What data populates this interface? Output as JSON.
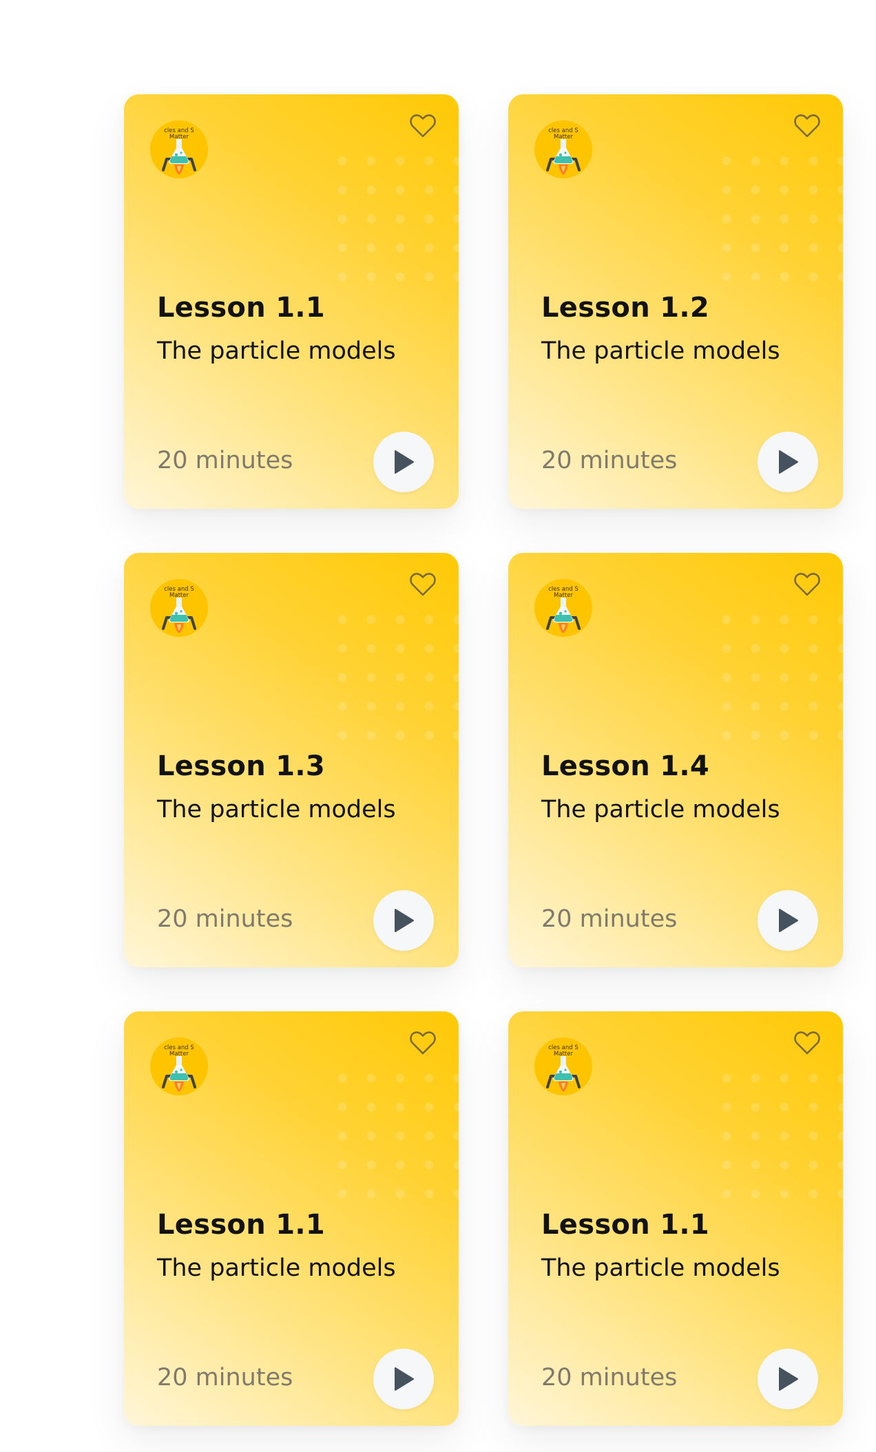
{
  "colors": {
    "card_top": "#ffc905",
    "card_bottom": "#fff6d8",
    "play_icon": "#46525e",
    "heart_icon": "#7a6a3a",
    "duration_text": "#7f7a6c"
  },
  "lessons": [
    {
      "title": "Lesson 1.1",
      "subtitle": "The particle models",
      "duration": "20 minutes",
      "thumbnail_text": [
        "cles and S",
        "Matter"
      ]
    },
    {
      "title": "Lesson 1.2",
      "subtitle": "The particle models",
      "duration": "20 minutes",
      "thumbnail_text": [
        "cles and S",
        "Matter"
      ]
    },
    {
      "title": "Lesson 1.3",
      "subtitle": "The particle models",
      "duration": "20 minutes",
      "thumbnail_text": [
        "cles and S",
        "Matter"
      ]
    },
    {
      "title": "Lesson 1.4",
      "subtitle": "The particle models",
      "duration": "20 minutes",
      "thumbnail_text": [
        "cles and S",
        "Matter"
      ]
    },
    {
      "title": "Lesson 1.1",
      "subtitle": "The particle models",
      "duration": "20 minutes",
      "thumbnail_text": [
        "cles and S",
        "Matter"
      ]
    },
    {
      "title": "Lesson 1.1",
      "subtitle": "The particle models",
      "duration": "20 minutes",
      "thumbnail_text": [
        "cles and S",
        "Matter"
      ]
    }
  ]
}
